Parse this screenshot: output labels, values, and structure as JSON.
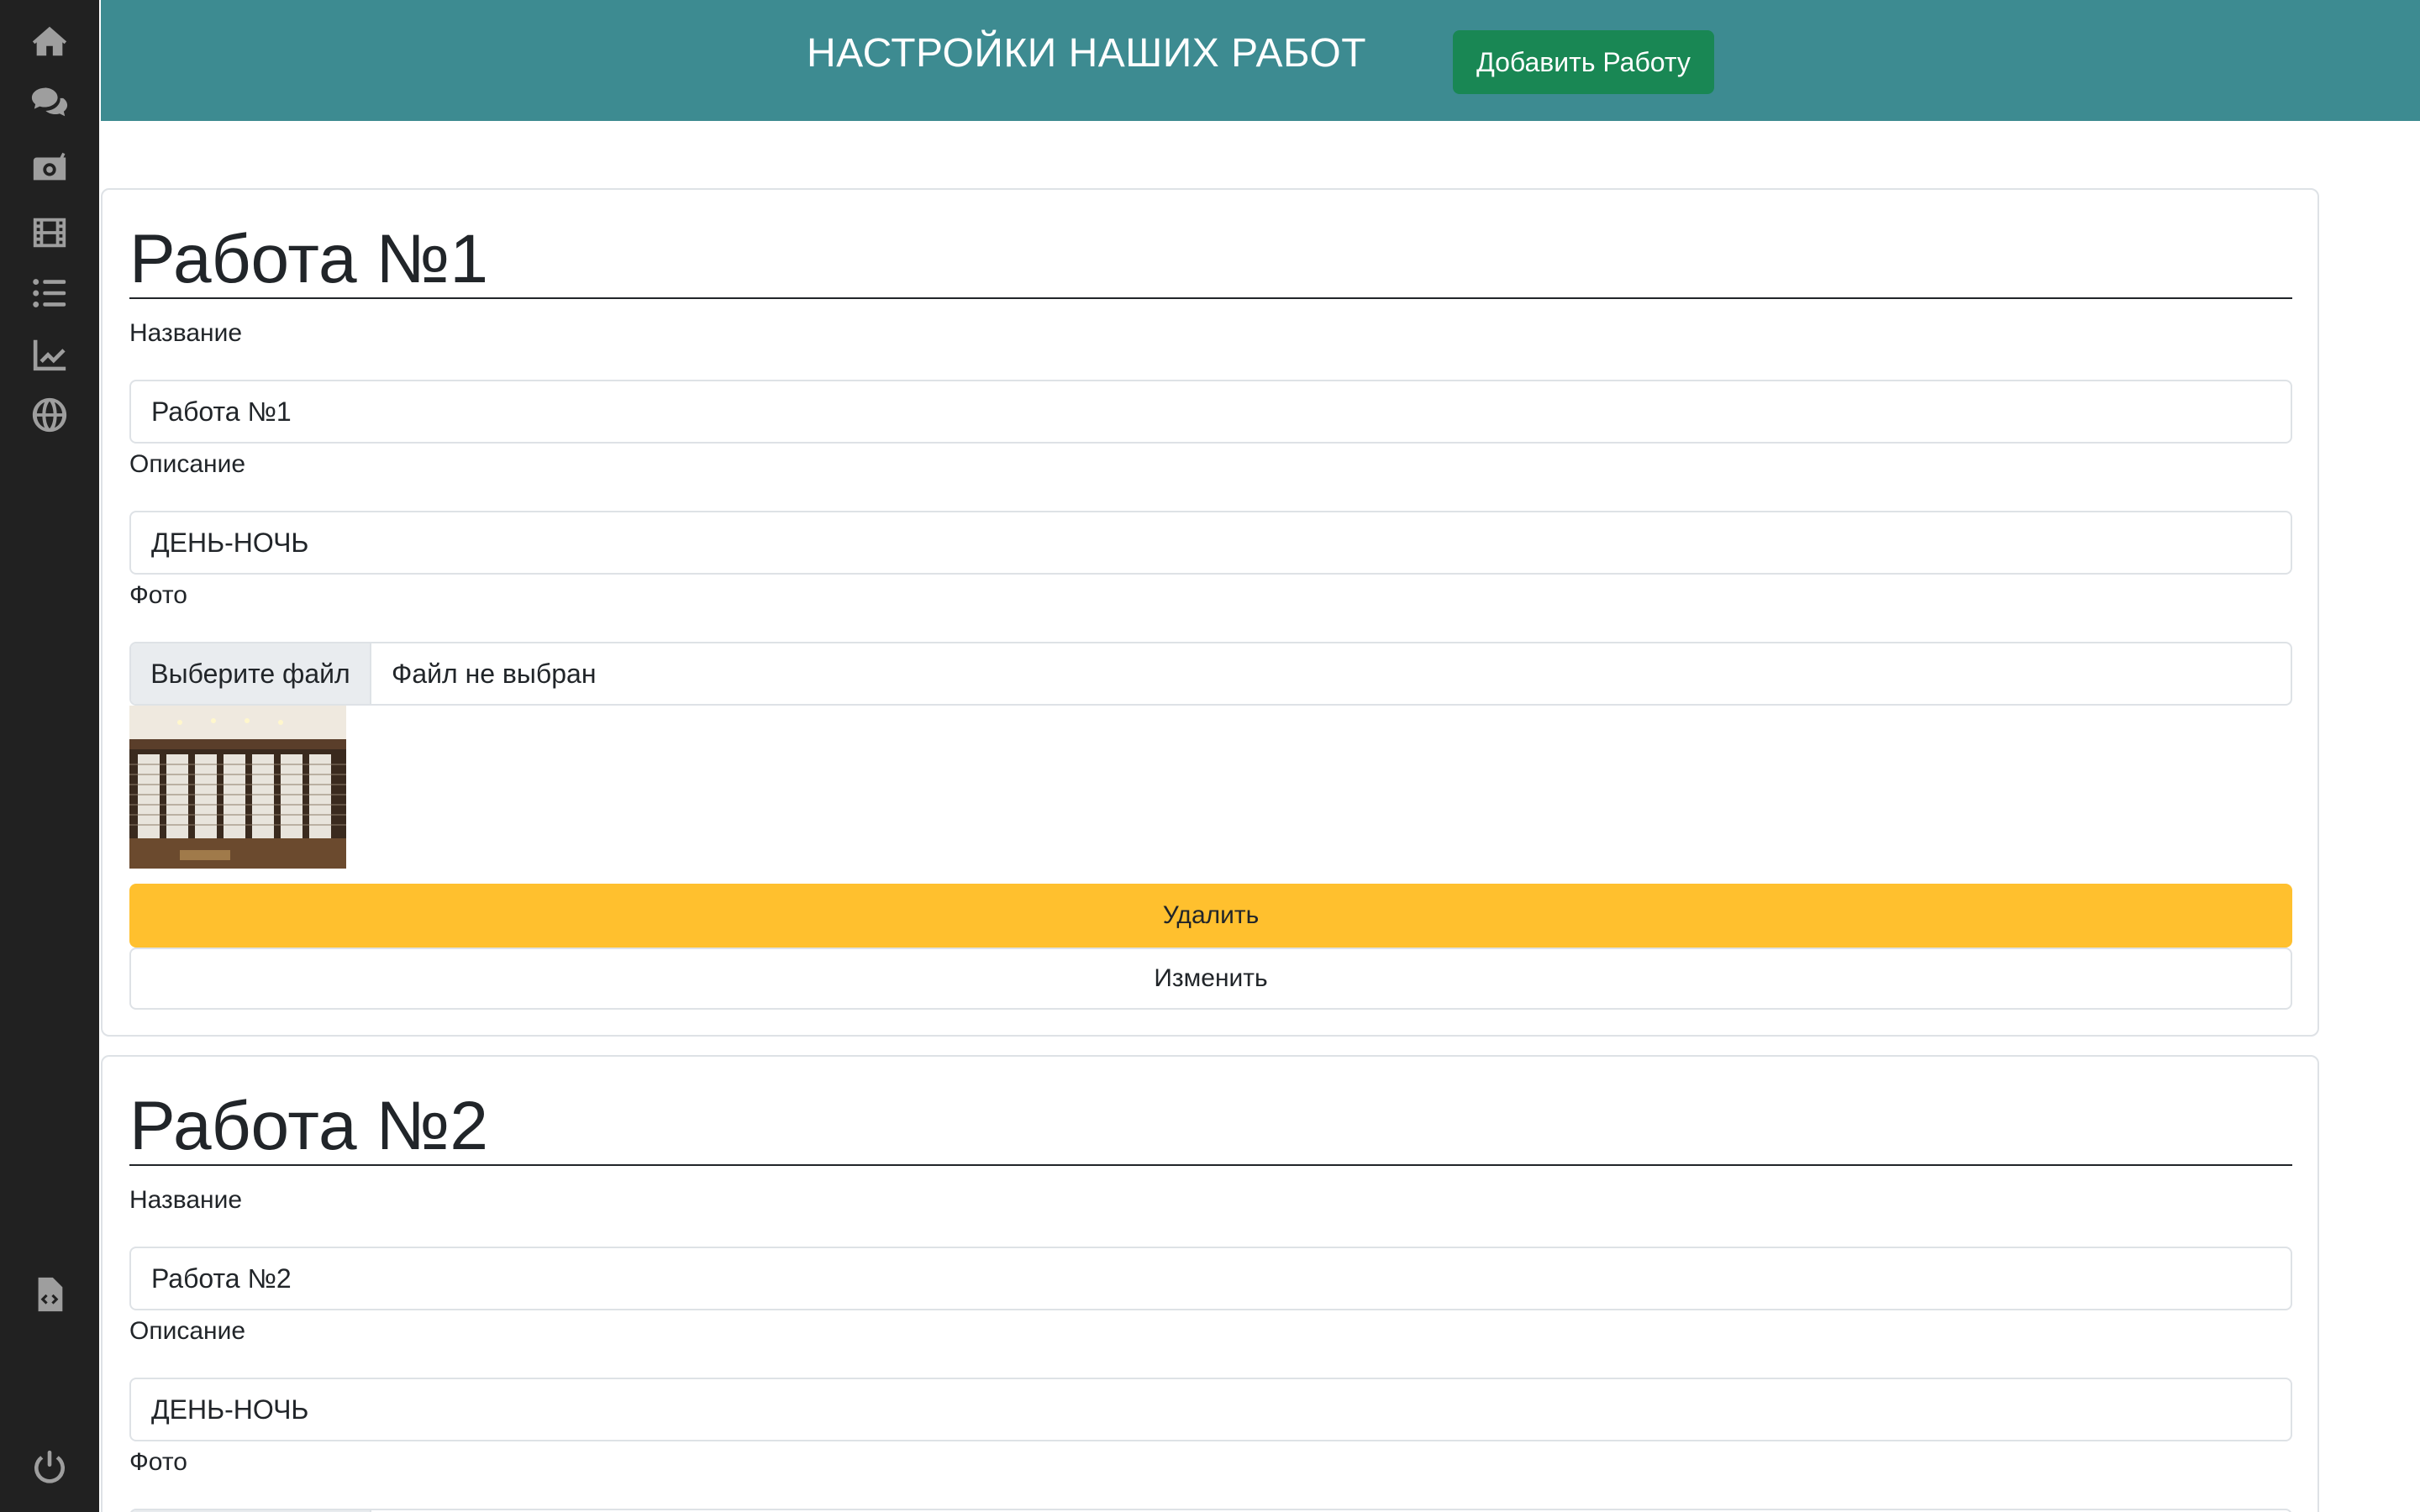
{
  "sidebar": {
    "items": [
      {
        "icon": "home-icon"
      },
      {
        "icon": "comments-icon"
      },
      {
        "icon": "radio-icon"
      },
      {
        "icon": "film-icon"
      },
      {
        "icon": "list-icon"
      },
      {
        "icon": "chart-line-icon"
      },
      {
        "icon": "globe-icon"
      }
    ],
    "bottom_items": [
      {
        "icon": "file-code-icon"
      },
      {
        "icon": "power-icon"
      }
    ]
  },
  "header": {
    "title": "НАСТРОЙКИ НАШИХ РАБОТ",
    "add_button": "Добавить Работу"
  },
  "works": [
    {
      "title": "Работа №1",
      "name_label": "Название",
      "name_value": "Работа №1",
      "description_label": "Описание",
      "description_value": "ДЕНЬ-НОЧЬ",
      "photo_label": "Фото",
      "file_button": "Выберите файл",
      "file_status": "Файл не выбран",
      "delete_button": "Удалить",
      "edit_button": "Изменить"
    },
    {
      "title": "Работа №2",
      "name_label": "Название",
      "name_value": "Работа №2",
      "description_label": "Описание",
      "description_value": "ДЕНЬ-НОЧЬ",
      "photo_label": "Фото"
    }
  ],
  "colors": {
    "header_bg": "#3d8b91",
    "add_button_bg": "#198754",
    "delete_button_bg": "#ffc02e",
    "sidebar_bg": "#212121"
  }
}
